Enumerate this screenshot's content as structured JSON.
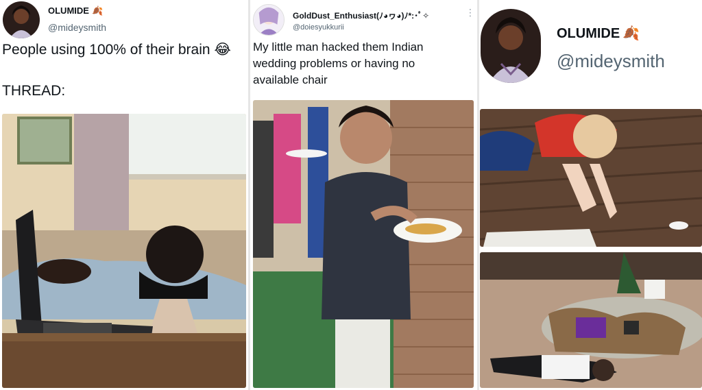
{
  "post_left": {
    "author_name": "OLUMIDE",
    "author_emoji": "🍂",
    "handle": "@mideysmith",
    "text_line1": "People using 100% of their brain",
    "text_emoji": "😂",
    "text_line2": "THREAD:",
    "photo_icon": "sleeping-mannequin-laptop-photo"
  },
  "post_middle": {
    "author_name": "GoldDust_Enthusiast(ﾉ◕ヮ◕)ﾉ*:･ﾟ✧",
    "handle": "@doiesyukkurii",
    "text": "My little man hacked them Indian wedding problems or having no available chair",
    "photo_icon": "boy-plate-on-wall-photo"
  },
  "post_right": {
    "author_name": "OLUMIDE",
    "author_emoji": "🍂",
    "handle": "@mideysmith",
    "photo_top_icon": "child-writing-on-deck-photo",
    "photo_bottom_icon": "boy-under-glass-table-photo"
  },
  "colors": {
    "text": "#0f1419",
    "handle": "#536471",
    "divider": "#e6e6e6"
  }
}
